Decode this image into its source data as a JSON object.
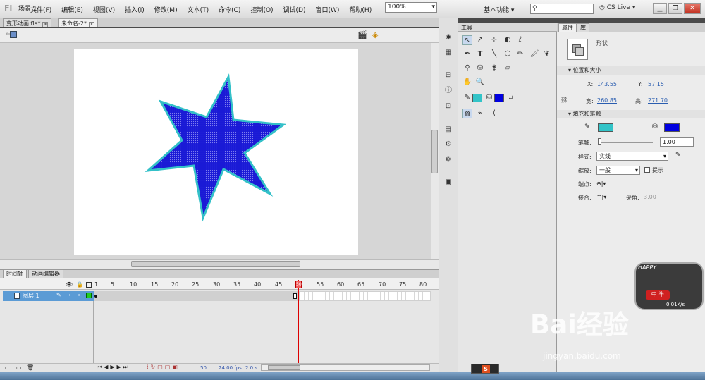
{
  "menubar": {
    "items": [
      "文件(F)",
      "编辑(E)",
      "视图(V)",
      "插入(I)",
      "修改(M)",
      "文本(T)",
      "命令(C)",
      "控制(O)",
      "调试(D)",
      "窗口(W)",
      "帮助(H)"
    ],
    "workspace": "基本功能",
    "search_placeholder": "",
    "cslive": "CS Live"
  },
  "doc_tabs": [
    {
      "label": "变形动画.fla*"
    },
    {
      "label": "未命名-2*"
    }
  ],
  "editbar": {
    "scene": "场景 1",
    "zoom": "100%"
  },
  "stage": {
    "star_fill": "#1a1ad6",
    "star_stroke": "#33c0c8"
  },
  "timeline": {
    "tabs": [
      "时间轴",
      "动画编辑器"
    ],
    "ruler": [
      "1",
      "5",
      "10",
      "15",
      "20",
      "25",
      "30",
      "35",
      "40",
      "45",
      "50",
      "55",
      "60",
      "65",
      "70",
      "75",
      "80"
    ],
    "playhead_frame": "50",
    "layer_name": "图层 1",
    "footer_frame": "50",
    "fps": "24.00 fps",
    "time": "2.0 s"
  },
  "tools": {
    "title": "工具",
    "stroke_color": "#33c4c8",
    "fill_color": "#0000e0"
  },
  "properties": {
    "tabs": [
      "属性",
      "库"
    ],
    "object_type": "形状",
    "section_position": "位置和大小",
    "x_label": "X:",
    "x_value": "143.55",
    "y_label": "Y:",
    "y_value": "57.15",
    "w_label": "宽:",
    "w_value": "260.85",
    "h_label": "高:",
    "h_value": "271.70",
    "section_fill": "填充和笔触",
    "stroke_label": "笔触:",
    "stroke_value": "1.00",
    "style_label": "样式:",
    "style_value": "实线",
    "scale_label": "缩放:",
    "scale_value": "一般",
    "hint_label": "提示",
    "cap_label": "端点:",
    "join_label": "接合:",
    "miter_label": "尖角:",
    "miter_value": "3.00",
    "stroke_color": "#33c4c8",
    "fill_color": "#0000e0"
  },
  "overlays": {
    "watermark": "Bai经验",
    "watermark_url": "jingyan.baidu.com",
    "happy": "HAPPY",
    "badge": "中 半",
    "speed": "0.01K/s"
  }
}
